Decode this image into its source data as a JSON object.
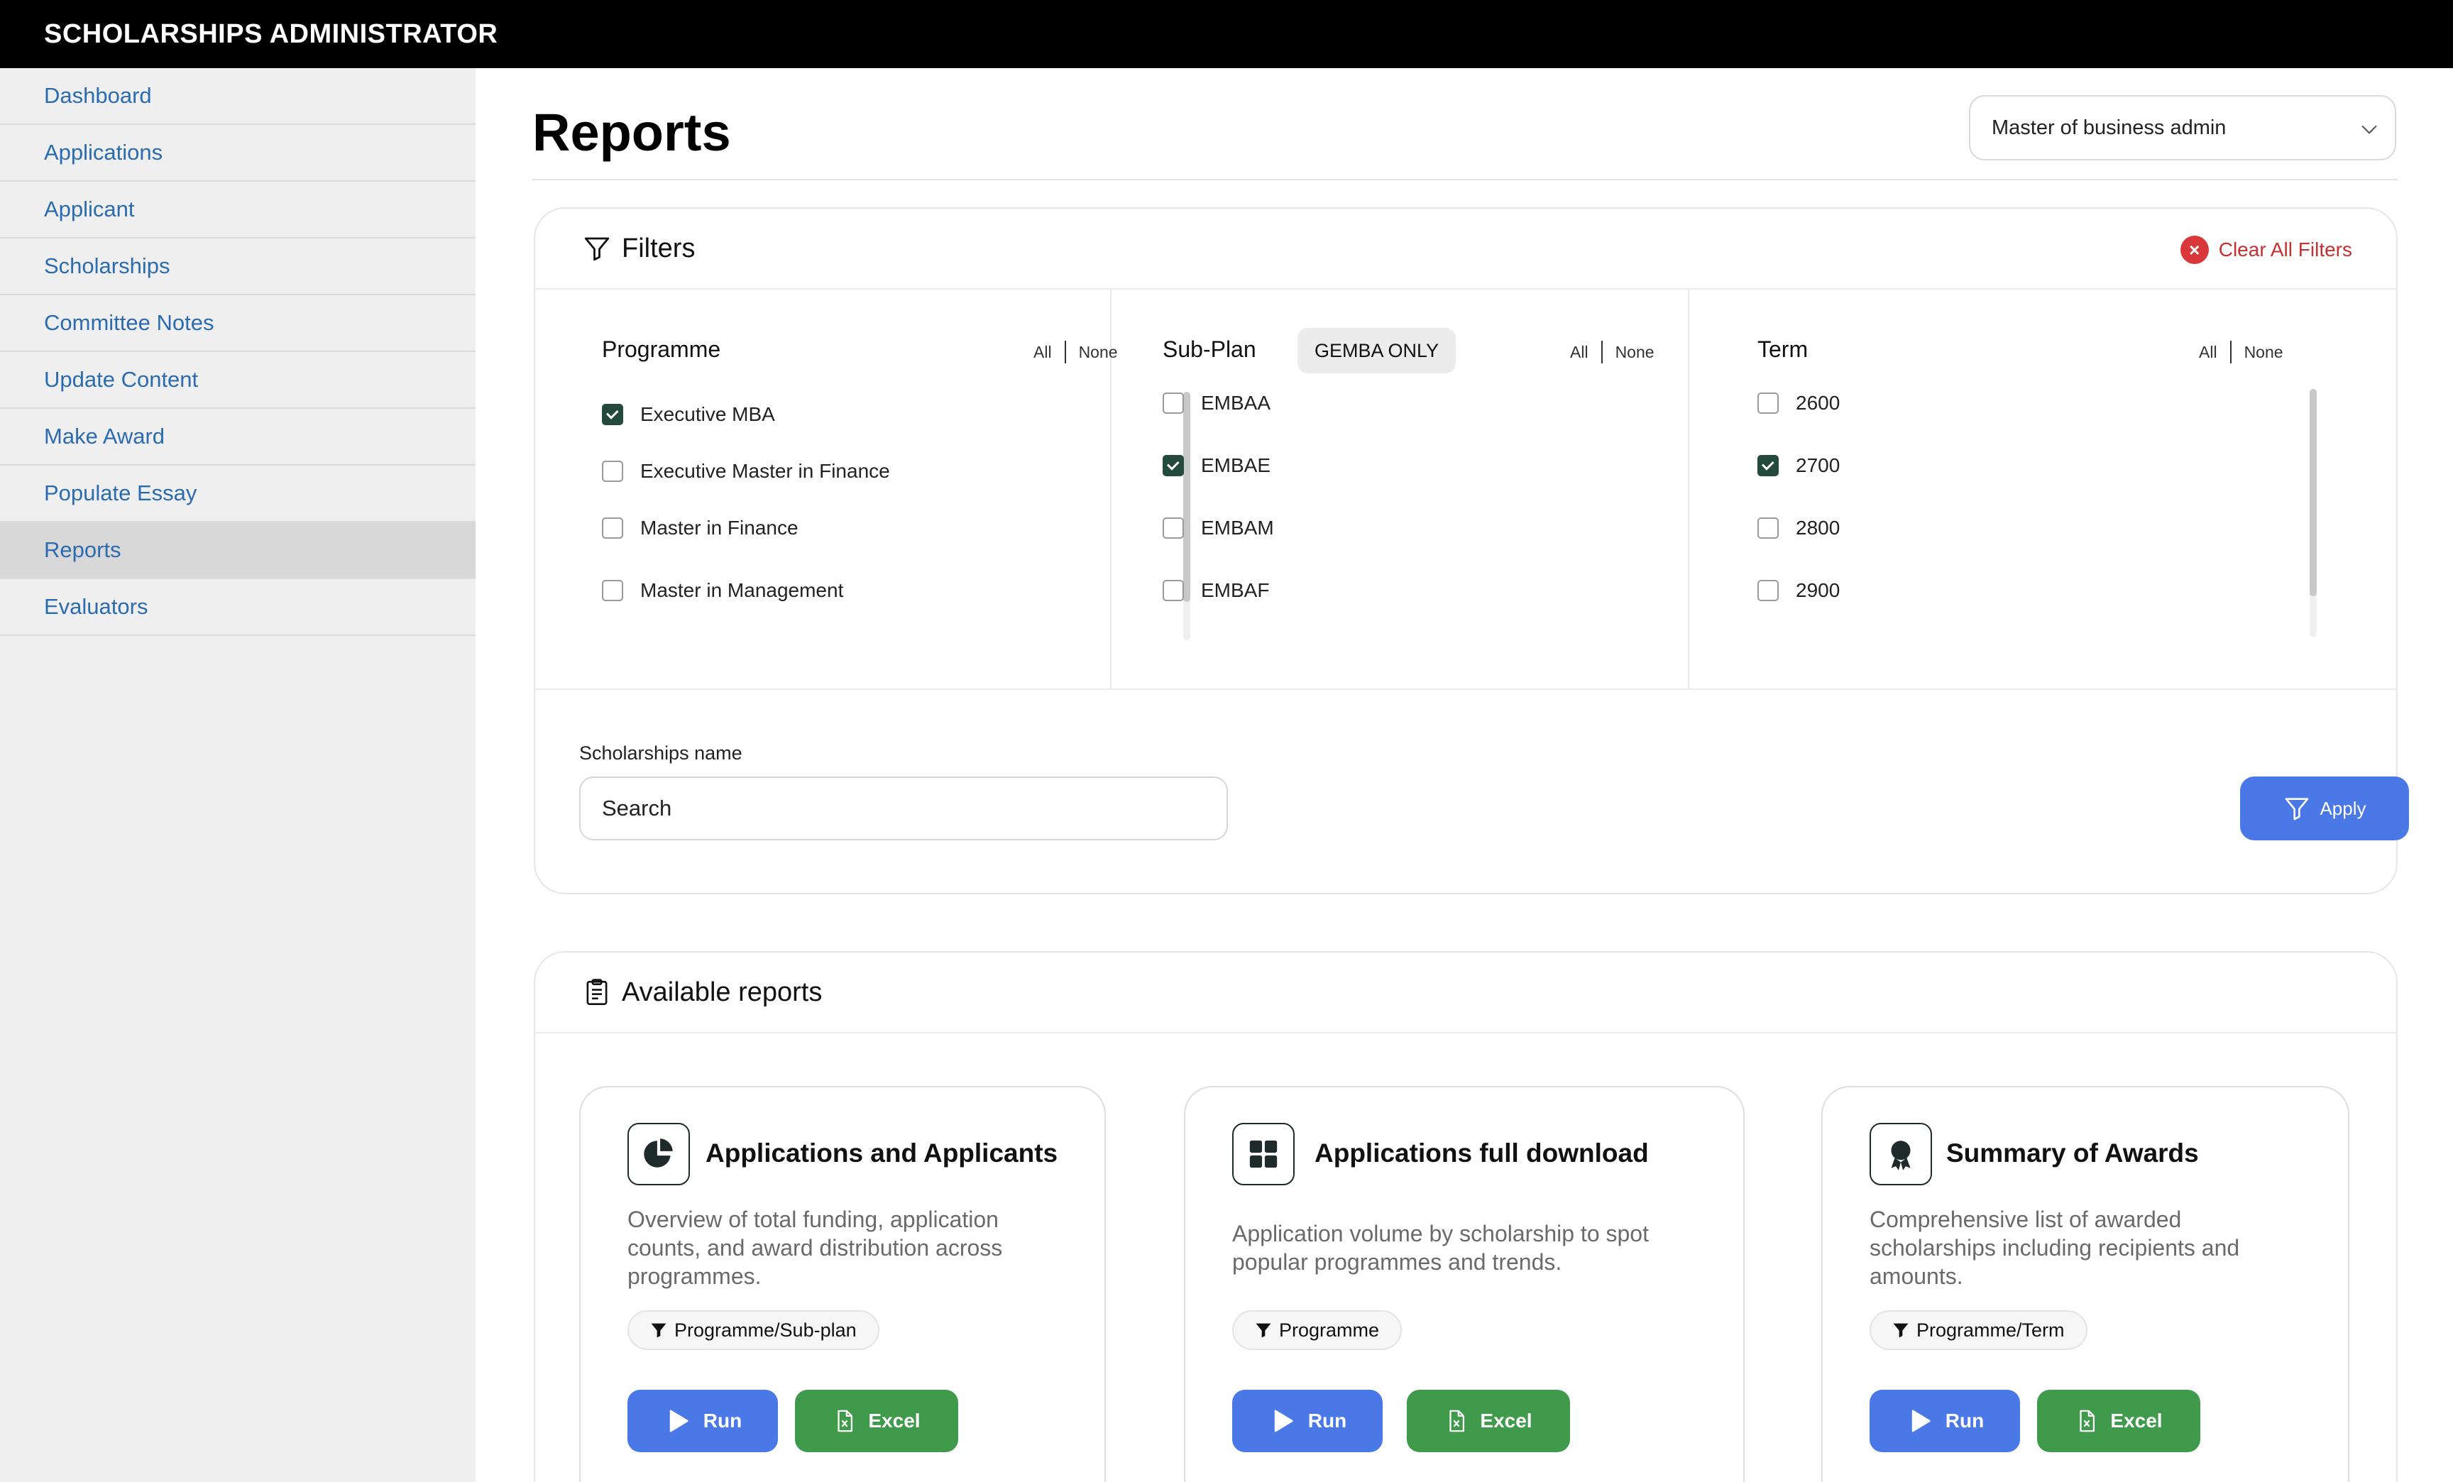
{
  "app": {
    "title": "SCHOLARSHIPS ADMINISTRATOR"
  },
  "sidebar": {
    "active": "Reports",
    "items": [
      {
        "label": "Dashboard"
      },
      {
        "label": "Applications"
      },
      {
        "label": "Applicant"
      },
      {
        "label": "Scholarships"
      },
      {
        "label": "Committee Notes"
      },
      {
        "label": "Update Content"
      },
      {
        "label": "Make Award"
      },
      {
        "label": "Populate Essay"
      },
      {
        "label": "Reports"
      },
      {
        "label": "Evaluators"
      }
    ]
  },
  "page": {
    "title": "Reports",
    "program_select": {
      "value": "Master of business admin",
      "icon": "chevron-down-icon"
    }
  },
  "filters": {
    "title": "Filters",
    "icon": "filter-icon",
    "clear_all": "Clear All Filters",
    "all_label": "All",
    "none_label": "None",
    "programme": {
      "title": "Programme",
      "options": [
        {
          "label": "Executive MBA",
          "checked": true
        },
        {
          "label": "Executive Master in Finance",
          "checked": false
        },
        {
          "label": "Master in Finance",
          "checked": false
        },
        {
          "label": "Master in Management",
          "checked": false
        }
      ]
    },
    "subplan": {
      "title": "Sub-Plan",
      "badge": "GEMBA ONLY",
      "options": [
        {
          "label": "EMBAA",
          "checked": false
        },
        {
          "label": "EMBAE",
          "checked": true
        },
        {
          "label": "EMBAM",
          "checked": false
        },
        {
          "label": "EMBAF",
          "checked": false
        }
      ]
    },
    "term": {
      "title": "Term",
      "options": [
        {
          "label": "2600",
          "checked": false
        },
        {
          "label": "2700",
          "checked": true
        },
        {
          "label": "2800",
          "checked": false
        },
        {
          "label": "2900",
          "checked": false
        }
      ]
    },
    "search": {
      "label": "Scholarships name",
      "placeholder": "Search",
      "value": ""
    },
    "apply": "Apply"
  },
  "reports": {
    "title": "Available reports",
    "icon": "clipboard-icon",
    "run_label": "Run",
    "excel_label": "Excel",
    "colors": {
      "run": "#4a78e6",
      "excel": "#3f9a4b",
      "checkbox": "#234a3d"
    },
    "items": [
      {
        "title": "Applications and Applicants",
        "icon": "pie-chart-icon",
        "description": "Overview of total funding, application counts, and award distribution across programmes.",
        "tag": "Programme/Sub-plan"
      },
      {
        "title": "Applications full download",
        "icon": "grid-icon",
        "description": "Application volume by scholarship to spot popular programmes and trends.",
        "tag": "Programme"
      },
      {
        "title": "Summary of Awards",
        "icon": "award-icon",
        "description": "Comprehensive list of awarded scholarships including recipients and amounts.",
        "tag": "Programme/Term"
      }
    ]
  }
}
